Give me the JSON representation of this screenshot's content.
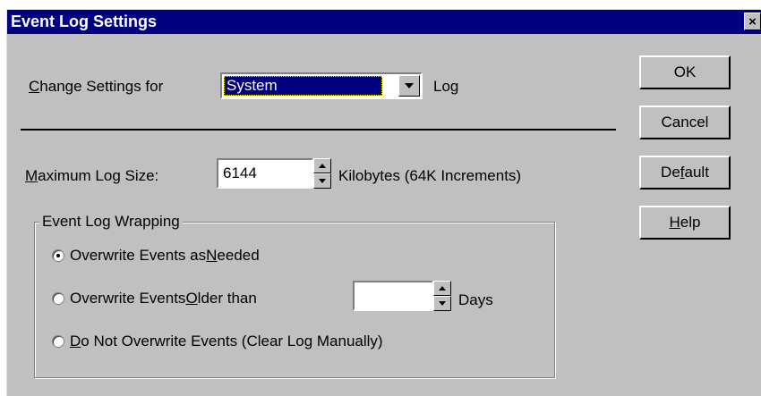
{
  "window": {
    "title": "Event Log Settings",
    "close_glyph": "×"
  },
  "change_settings": {
    "label_prefix": "",
    "label_accel": "C",
    "label_rest": "hange Settings for",
    "selected": "System",
    "suffix": "Log"
  },
  "max_log_size": {
    "label_accel": "M",
    "label_rest": "aximum Log Size:",
    "value": "6144",
    "units": "Kilobytes  (64K Increments)"
  },
  "wrapping": {
    "legend": "Event Log Wrapping",
    "options": [
      {
        "pre": "Overwrite Events as ",
        "accel": "N",
        "post": "eeded",
        "checked": true
      },
      {
        "pre": "Overwrite Events ",
        "accel": "O",
        "post": "lder than",
        "checked": false
      },
      {
        "pre": "",
        "accel": "D",
        "post": "o Not Overwrite Events (Clear Log Manually)",
        "checked": false
      }
    ],
    "days_value": "",
    "days_label": "Days"
  },
  "buttons": {
    "ok": "OK",
    "cancel": "Cancel",
    "default_pre": "De",
    "default_accel": "f",
    "default_post": "ault",
    "help_pre": "",
    "help_accel": "H",
    "help_post": "elp"
  }
}
